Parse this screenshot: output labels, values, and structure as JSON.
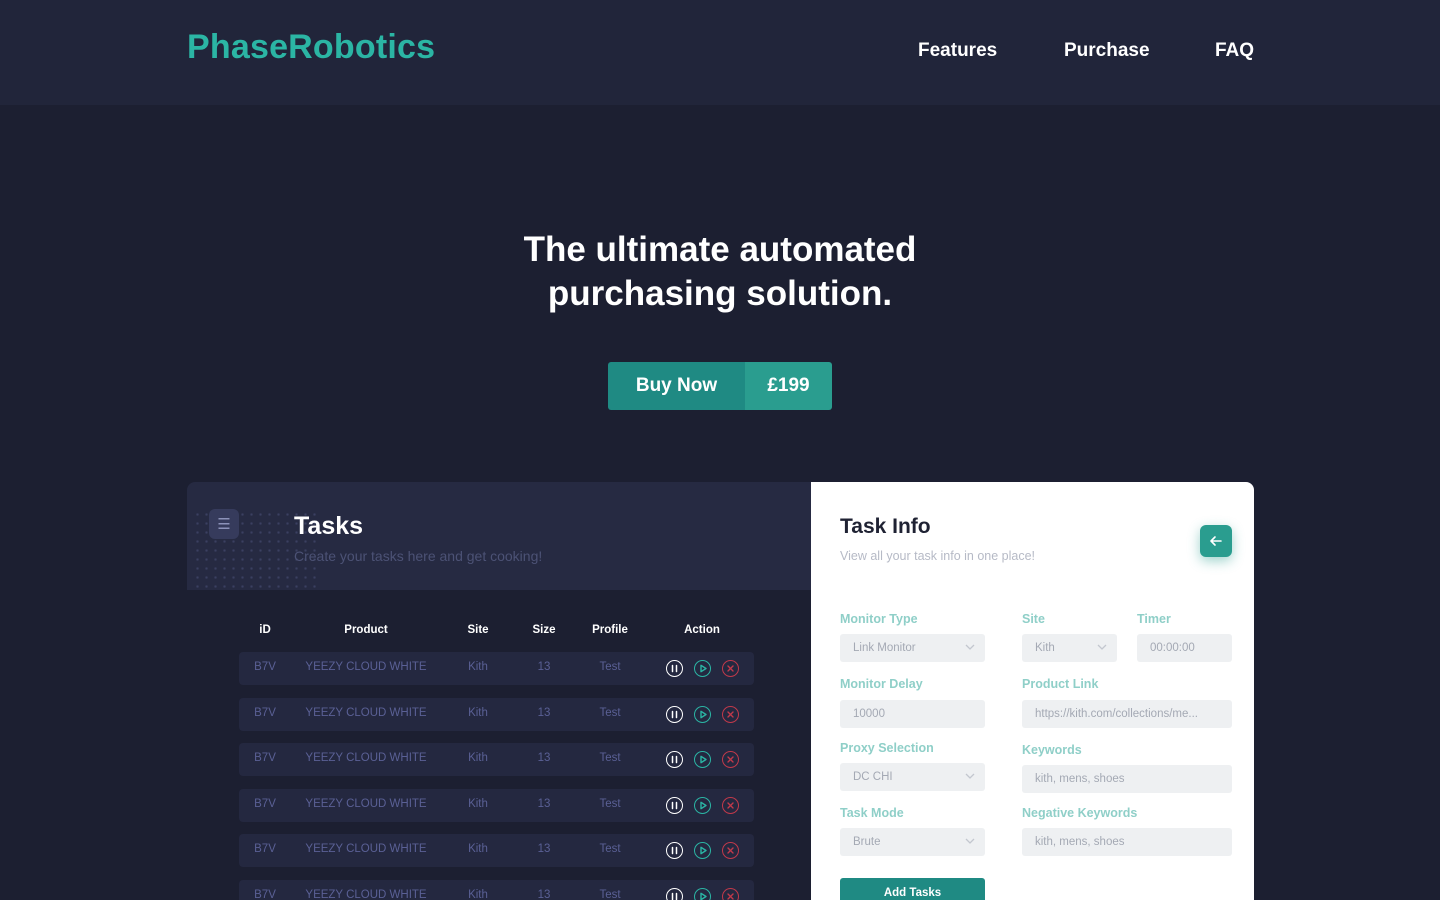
{
  "brand": {
    "logo": "PhaseRobotics"
  },
  "nav": {
    "items": [
      "Features",
      "Purchase",
      "FAQ"
    ]
  },
  "hero": {
    "title_line1": "The ultimate automated",
    "title_line2": "purchasing solution.",
    "buy_label": "Buy Now",
    "buy_price": "£199"
  },
  "colors": {
    "accent": "#2bb5a4",
    "button_dark": "#1f8a83",
    "background": "#1c1f31",
    "danger": "#c0394a"
  },
  "tasks": {
    "title": "Tasks",
    "subtitle": "Create your tasks here and get cooking!",
    "menu_icon": "menu-icon",
    "columns": [
      "iD",
      "Product",
      "Site",
      "Size",
      "Profile",
      "Action"
    ],
    "rows": [
      {
        "id": "B7V",
        "product": "YEEZY CLOUD WHITE",
        "site": "Kith",
        "size": "13",
        "profile": "Test"
      },
      {
        "id": "B7V",
        "product": "YEEZY CLOUD WHITE",
        "site": "Kith",
        "size": "13",
        "profile": "Test"
      },
      {
        "id": "B7V",
        "product": "YEEZY CLOUD WHITE",
        "site": "Kith",
        "size": "13",
        "profile": "Test"
      },
      {
        "id": "B7V",
        "product": "YEEZY CLOUD WHITE",
        "site": "Kith",
        "size": "13",
        "profile": "Test"
      },
      {
        "id": "B7V",
        "product": "YEEZY CLOUD WHITE",
        "site": "Kith",
        "size": "13",
        "profile": "Test"
      },
      {
        "id": "B7V",
        "product": "YEEZY CLOUD WHITE",
        "site": "Kith",
        "size": "13",
        "profile": "Test"
      }
    ],
    "action_icons": [
      "pause-icon",
      "play-icon",
      "delete-icon"
    ]
  },
  "task_info": {
    "title": "Task Info",
    "subtitle": "View all your task info in one place!",
    "back_icon": "arrow-left-icon",
    "monitor_type": {
      "label": "Monitor Type",
      "value": "Link Monitor"
    },
    "site": {
      "label": "Site",
      "value": "Kith"
    },
    "timer": {
      "label": "Timer",
      "value": "00:00:00"
    },
    "monitor_delay": {
      "label": "Monitor Delay",
      "value": "10000"
    },
    "product_link": {
      "label": "Product Link",
      "value": "https://kith.com/collections/me..."
    },
    "proxy_selection": {
      "label": "Proxy Selection",
      "value": "DC CHI"
    },
    "keywords": {
      "label": "Keywords",
      "value": "kith, mens, shoes"
    },
    "task_mode": {
      "label": "Task Mode",
      "value": "Brute"
    },
    "negative_keywords": {
      "label": "Negative Keywords",
      "value": "kith, mens, shoes"
    },
    "add_button": "Add Tasks"
  }
}
